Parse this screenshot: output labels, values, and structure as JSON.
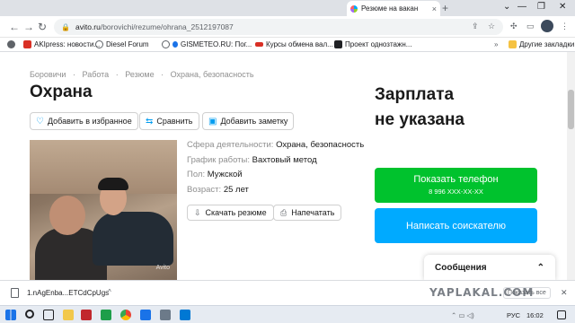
{
  "browser": {
    "tab_title": "Резюме на вакан",
    "tab_close": "×",
    "new_tab": "+",
    "url_host": "avito.ru",
    "url_path": "/borovichi/rezume/ohrana_2512197087",
    "window_controls": [
      "⌄",
      "—",
      "❐",
      "✕"
    ]
  },
  "bookmarks": [
    {
      "label": "",
      "icon": "apps-grid-icon",
      "color": "#5f6368"
    },
    {
      "label": "AKIpress: новости...",
      "icon": "akipress-icon",
      "color": "#d93025"
    },
    {
      "label": "Diesel Forum",
      "icon": "globe-icon",
      "color": "#5f6368"
    },
    {
      "label": "GISMETEO.RU: Пог...",
      "icon": "gismeteo-icon",
      "color": "#1a73e8"
    },
    {
      "label": "Курсы обмена вал...",
      "icon": "currency-icon",
      "color": "#d93025"
    },
    {
      "label": "Проект однозтажн...",
      "icon": "project-icon",
      "color": "#202124"
    }
  ],
  "bookmarks_other": "Другие закладки",
  "page": {
    "breadcrumbs": [
      "Боровичи",
      "·",
      "Работа",
      "·",
      "Резюме",
      "·",
      "Охрана, безопасность"
    ],
    "title": "Охрана",
    "actions": {
      "favorite": "Добавить в избранное",
      "compare": "Сравнить",
      "note": "Добавить заметку"
    },
    "photo_watermark": "Avito",
    "details": [
      {
        "label": "Сфера деятельности:",
        "value": "Охрана, безопасность"
      },
      {
        "label": "График работы:",
        "value": "Вахтовый метод"
      },
      {
        "label": "Пол:",
        "value": "Мужской"
      },
      {
        "label": "Возраст:",
        "value": "25 лет"
      }
    ],
    "download_resume": "Скачать резюме",
    "print": "Напечатать",
    "salary_line1": "Зарплата",
    "salary_line2": "не указана",
    "show_phone": "Показать телефон",
    "phone_masked": "8 996 XXX-XX-XX",
    "write_applicant": "Написать соискателю",
    "messages": "Сообщения"
  },
  "download_bar": {
    "file_name": "1.nAgEnba...ETCdCpUgs",
    "more": "^",
    "watermark": "YAPLAKAL.COM",
    "show_all": "Показать все",
    "close": "✕"
  },
  "taskbar": {
    "lang": "РУС",
    "time": "16:02"
  },
  "colors": {
    "green": "#00c22d",
    "blue": "#00aaff"
  }
}
